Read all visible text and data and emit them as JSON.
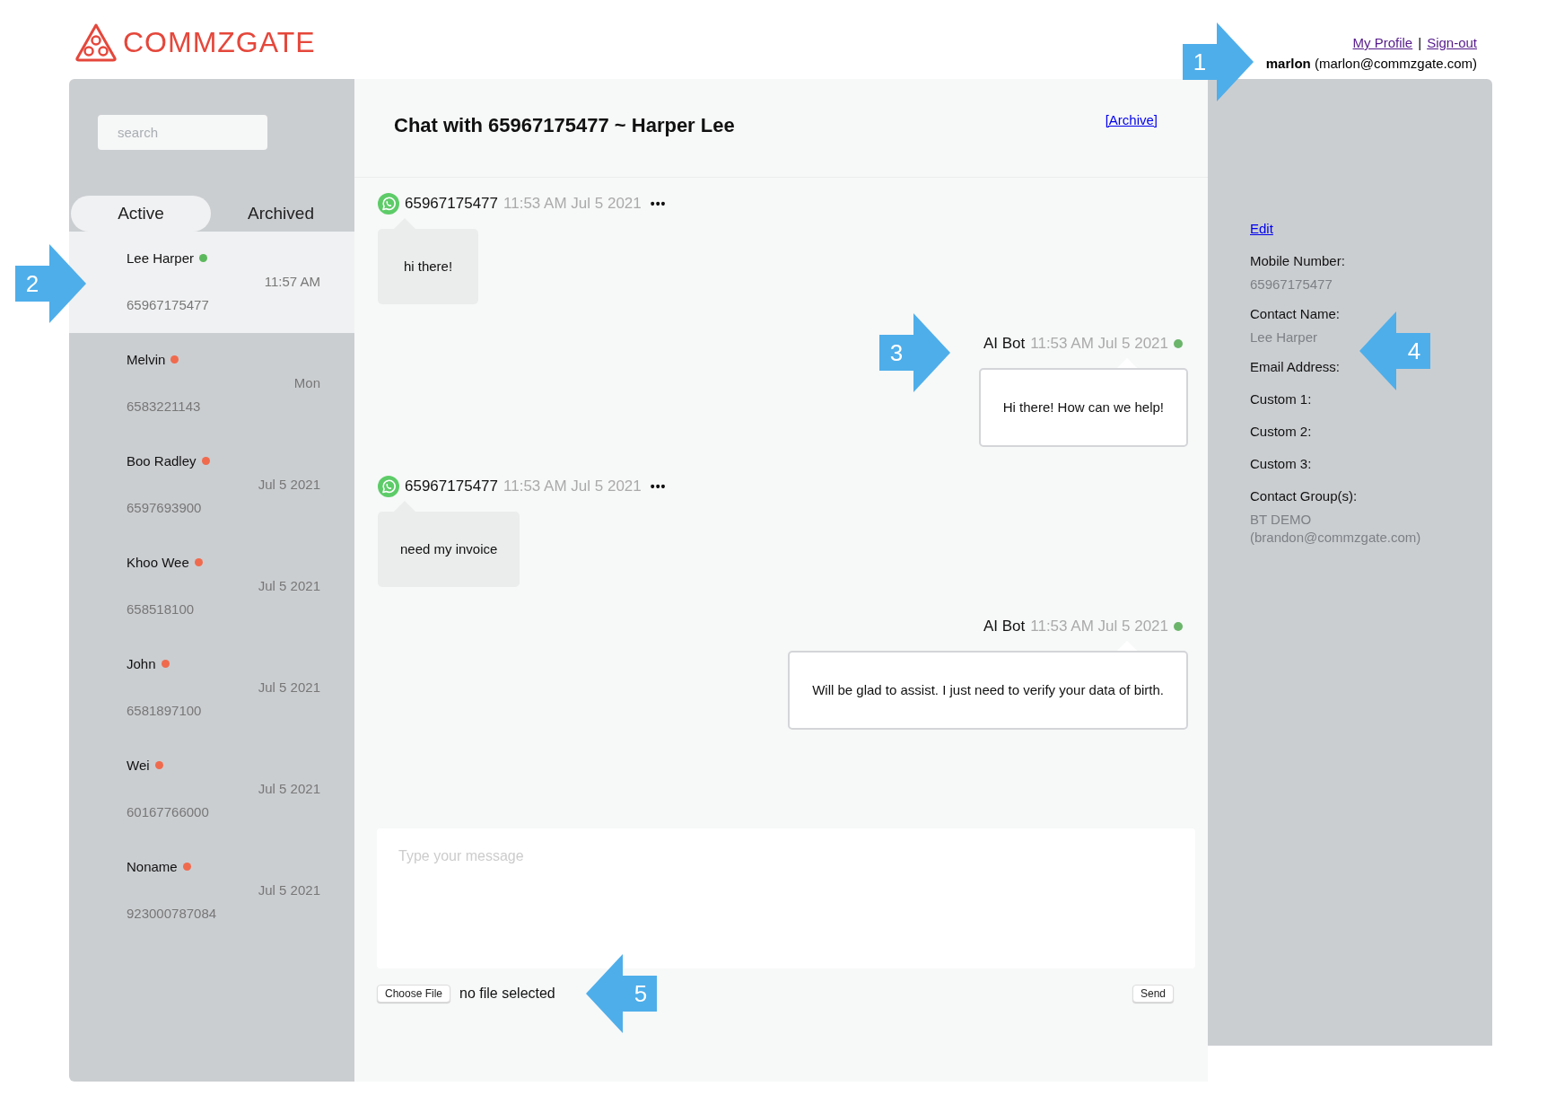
{
  "header": {
    "logo": "COMMZGATE",
    "links": [
      {
        "label": "My Profile"
      },
      {
        "label": "Sign-out"
      }
    ],
    "separator": "|",
    "user_name": "marlon",
    "user_email": "(marlon@commzgate.com)"
  },
  "sidebar": {
    "search": {
      "placeholder": "search"
    },
    "tabs": [
      {
        "label": "Active",
        "selected": true
      },
      {
        "label": "Archived",
        "selected": false
      }
    ],
    "conversations": [
      {
        "name": "Lee Harper",
        "color": "#5cb85c",
        "time": "11:57 AM",
        "phone": "65967175477",
        "selected": true
      },
      {
        "name": "Melvin",
        "color": "#f06a4d",
        "time": "Mon",
        "phone": "6583221143",
        "selected": false
      },
      {
        "name": "Boo Radley",
        "color": "#f06a4d",
        "time": "Jul 5 2021",
        "phone": "6597693900",
        "selected": false
      },
      {
        "name": "Khoo Wee",
        "color": "#f06a4d",
        "time": "Jul 5 2021",
        "phone": "658518100",
        "selected": false
      },
      {
        "name": "John",
        "color": "#f06a4d",
        "time": "Jul 5 2021",
        "phone": "6581897100",
        "selected": false
      },
      {
        "name": "Wei",
        "color": "#f06a4d",
        "time": "Jul 5 2021",
        "phone": "60167766000",
        "selected": false
      },
      {
        "name": "Noname",
        "color": "#f06a4d",
        "time": "Jul 5 2021",
        "phone": "923000787084",
        "selected": false
      }
    ]
  },
  "chat": {
    "title": "Chat with 65967175477 ~ Harper Lee",
    "archive_link": "[Archive]",
    "messages": [
      {
        "kind": "incoming",
        "sender": "65967175477",
        "time": "11:53 AM Jul 5 2021",
        "menu": "•••",
        "text": "hi there!"
      },
      {
        "kind": "outgoing",
        "sender": "AI Bot",
        "time": "11:53 AM Jul 5 2021",
        "text": "Hi there! How can we help!"
      },
      {
        "kind": "incoming",
        "sender": "65967175477",
        "time": "11:53 AM Jul 5 2021",
        "menu": "•••",
        "text": "need my invoice"
      },
      {
        "kind": "outgoing",
        "sender": "AI Bot",
        "time": "11:53 AM Jul 5 2021",
        "text": "Will be glad to assist. I just need to verify your data of birth."
      }
    ],
    "composer": {
      "placeholder": "Type your message",
      "file_button": "Choose File",
      "file_status": "no file selected",
      "send": "Send"
    }
  },
  "contact": {
    "edit": "Edit",
    "fields": [
      {
        "label": "Mobile Number:",
        "value": "65967175477"
      },
      {
        "label": "Contact Name:",
        "value": "Lee Harper"
      },
      {
        "label": "Email Address:"
      },
      {
        "label": "Custom 1:"
      },
      {
        "label": "Custom 2:"
      },
      {
        "label": "Custom 3:"
      },
      {
        "label": "Contact Group(s):",
        "value": "BT DEMO (brandon@commzgate.com)"
      }
    ]
  },
  "callouts": [
    {
      "number": "1"
    },
    {
      "number": "2"
    },
    {
      "number": "3"
    },
    {
      "number": "4"
    },
    {
      "number": "5"
    }
  ]
}
